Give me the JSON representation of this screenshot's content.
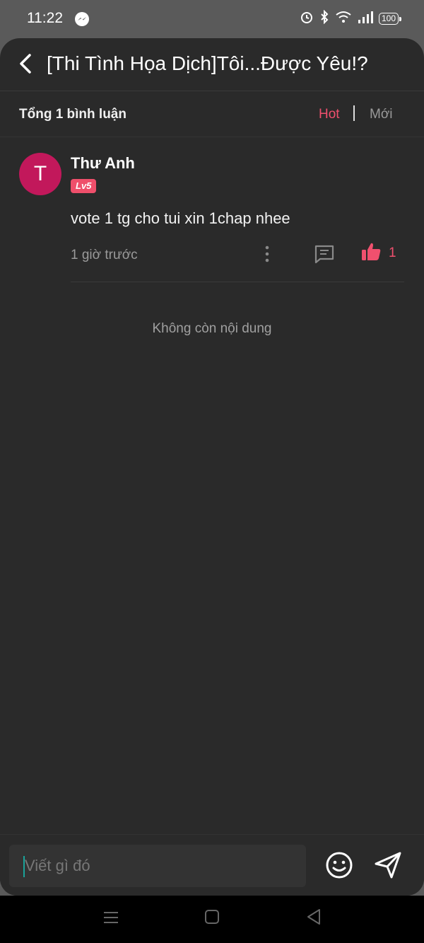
{
  "status_bar": {
    "time": "11:22",
    "battery": "100"
  },
  "header": {
    "title": "[Thi Tình Họa Dịch]Tôi...Được Yêu!?"
  },
  "subbar": {
    "total": "Tổng 1 bình luận",
    "sort_hot": "Hot",
    "sort_new": "Mới"
  },
  "comments": [
    {
      "avatar_letter": "T",
      "username": "Thư Anh",
      "level": "Lv5",
      "text": "vote 1 tg cho tui xin 1chap nhee",
      "time": "1 giờ trước",
      "likes": "1"
    }
  ],
  "empty_message": "Không còn nội dung",
  "composer": {
    "placeholder": "Viết gì đó"
  },
  "colors": {
    "accent": "#f0506e",
    "background": "#2a2a2a",
    "avatar": "#c2185b",
    "badge": "#ef4f6b"
  }
}
